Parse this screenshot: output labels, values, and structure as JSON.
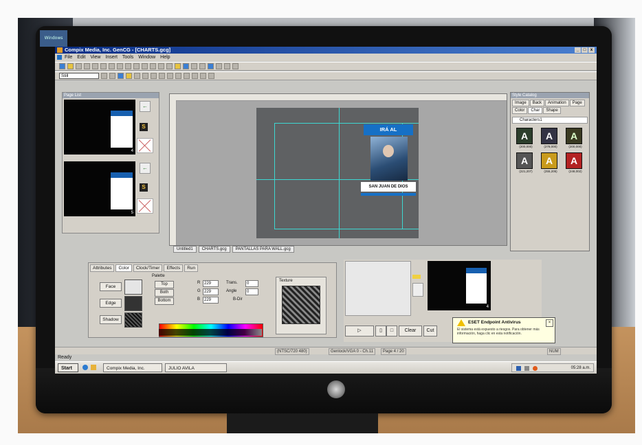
{
  "app": {
    "title": "Compix Media, Inc. GenCG - [CHARTS.gcg]",
    "menu": [
      "File",
      "Edit",
      "View",
      "Insert",
      "Tools",
      "Window",
      "Help"
    ],
    "style_select": "Still"
  },
  "page_list": {
    "title": "Page List",
    "pages": [
      {
        "number": "4",
        "marker": "S"
      },
      {
        "number": "5",
        "marker": "S"
      }
    ]
  },
  "canvas": {
    "graphic_title": "IRÁ AL",
    "graphic_label": "SAN JUAN DE DIOS"
  },
  "doc_tabs": [
    "Untitled1",
    "CHARTS.gcg",
    "PANTALLAS PARA WALL.gcg"
  ],
  "catalog": {
    "title": "Style Catalog",
    "tabs": [
      "Image",
      "Back",
      "Animation",
      "Page",
      "Color",
      "Char",
      "Shape"
    ],
    "section": "Characters1",
    "chars": [
      {
        "glyph": "A",
        "caption": "(200,000)"
      },
      {
        "glyph": "A",
        "caption": "(278,000)"
      },
      {
        "glyph": "A",
        "caption": "(200,000)"
      },
      {
        "glyph": "A",
        "caption": "(221,207)"
      },
      {
        "glyph": "A",
        "caption": "(255,205)"
      },
      {
        "glyph": "A",
        "caption": "(248,002)"
      }
    ]
  },
  "attributes": {
    "tabs": [
      "Attributes",
      "Color",
      "Clock/Timer",
      "Effects",
      "Run"
    ],
    "face_label": "Face",
    "edge_label": "Edge",
    "shadow_label": "Shadow",
    "palette_title": "Palette",
    "palette_buttons": [
      "Top",
      "Both",
      "Bottom"
    ],
    "rgb": {
      "r": "229",
      "g": "229",
      "b": "229"
    },
    "trans_label": "Trans.",
    "trans_value": "0",
    "angle_label": "Angle",
    "angle_value": "0",
    "bdir_label": "B-Dir",
    "texture_title": "Texture"
  },
  "preview": {
    "clear_label": "Clear",
    "cut_label": "Cut",
    "shot_number": "4"
  },
  "toast": {
    "title": "ESET Endpoint Antivirus",
    "body": "El sistema está expuesto a riesgos. Para obtener más información, haga clic en esta notificación."
  },
  "status": {
    "ready": "Ready",
    "ntsc": "(NTSC/720 480)",
    "device": "Genlock/VGA 0 - Ch.11",
    "page": "Page 4 / 20",
    "num": "NUM"
  },
  "taskbar": {
    "start": "Start",
    "item1": "Compix Media, Inc.",
    "item2": "JULIO AVILA",
    "clock": "05:28 a.m."
  },
  "colors": {
    "title_bar": "#0a2e86",
    "accent_blue": "#1670c6",
    "guide_cyan": "#3dd8d2",
    "toast_bg": "#ffffe1"
  }
}
